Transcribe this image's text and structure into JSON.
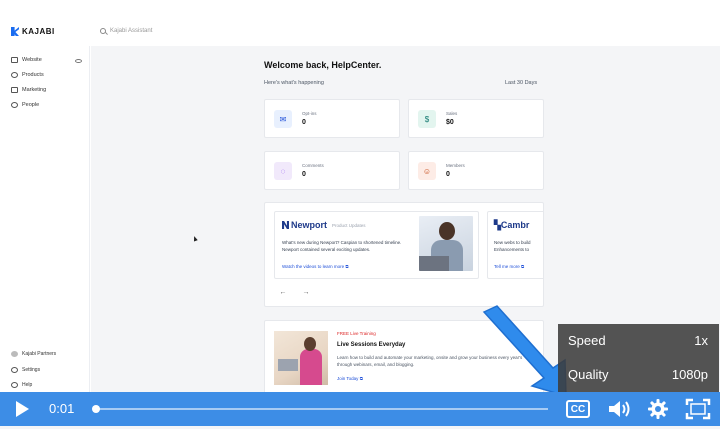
{
  "app": {
    "brand": "KAJABI",
    "search_placeholder": "Kajabi Assistant"
  },
  "sidebar": {
    "items": [
      {
        "label": "Website",
        "icon": "monitor-icon"
      },
      {
        "label": "Products",
        "icon": "box-icon"
      },
      {
        "label": "Marketing",
        "icon": "megaphone-icon"
      },
      {
        "label": "People",
        "icon": "people-icon"
      }
    ],
    "bottom": [
      {
        "label": "Kajabi Partners",
        "icon": "partner-icon"
      },
      {
        "label": "Settings",
        "icon": "gear-icon"
      },
      {
        "label": "Help",
        "icon": "help-icon"
      }
    ]
  },
  "dashboard": {
    "welcome": "Welcome back, HelpCenter.",
    "subtitle": "Here's what's happening",
    "range": "Last 30 Days",
    "stats": [
      {
        "label": "Opt-ins",
        "value": "0",
        "icon": "mail-icon",
        "color": "#e8f0fe"
      },
      {
        "label": "Sales",
        "value": "$0",
        "icon": "dollar-icon",
        "color": "#e3f5ef"
      },
      {
        "label": "Comments",
        "value": "0",
        "icon": "comment-icon",
        "color": "#f1e9fb"
      },
      {
        "label": "Members",
        "value": "0",
        "icon": "members-icon",
        "color": "#fdece6"
      }
    ]
  },
  "carousel": {
    "card1": {
      "brand": "Newport",
      "tag": "Product Updates",
      "description": "What's new during Newport? Caspian to shortened timeline. Newport contained several exciting updates.",
      "link": "Watch the videos to learn more"
    },
    "card2": {
      "brand": "Cambr",
      "description": "New webs to build Enhancements to",
      "link": "Tell me more"
    },
    "prev": "←",
    "next": "→"
  },
  "live": {
    "tag": "FREE Live Training",
    "title": "Live Sessions Everyday",
    "description": "Learn how to build and automate your marketing, onsite and grow your business every year's through webinars, email, and blogging.",
    "link": "Join Today"
  },
  "popover": {
    "speed_label": "Speed",
    "speed_value": "1x",
    "quality_label": "Quality",
    "quality_value": "1080p"
  },
  "player": {
    "time": "0:01",
    "cc": "CC",
    "progress": 0.004
  },
  "colors": {
    "accent": "#3d8de6",
    "brand": "#1a6cf0",
    "popover": "#3c3c3c"
  }
}
